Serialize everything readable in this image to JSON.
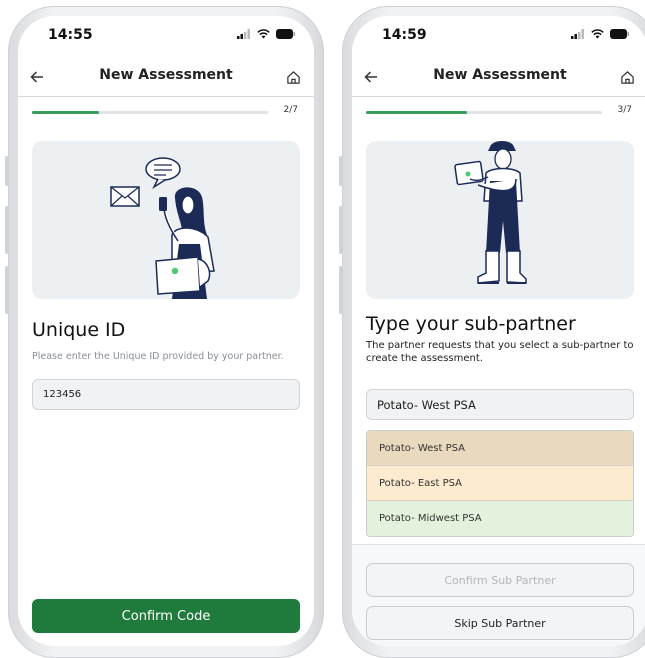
{
  "screen1": {
    "status_time": "14:55",
    "title": "New Assessment",
    "progress": {
      "label": "2/7",
      "fraction": 0.2857
    },
    "heading": "Unique ID",
    "subtext": "Please enter the Unique ID provided by your partner.",
    "input_value": "123456",
    "confirm_button": "Confirm Code"
  },
  "screen2": {
    "status_time": "14:59",
    "title": "New Assessment",
    "progress": {
      "label": "3/7",
      "fraction": 0.4286
    },
    "heading": "Type your sub-partner",
    "subtext": "The partner requests that you select a sub-partner to create the assessment.",
    "input_value": "Potato- West PSA",
    "options": [
      {
        "label": "Potato- West PSA",
        "color": "#e9d9bf"
      },
      {
        "label": "Potato- East PSA",
        "color": "#fdebd0"
      },
      {
        "label": "Potato- Midwest PSA",
        "color": "#e3f2dc"
      }
    ],
    "confirm_button": "Confirm Sub Partner",
    "skip_button": "Skip Sub Partner"
  },
  "colors": {
    "primary_green": "#1e7b3c",
    "progress_green": "#3a9b5c",
    "illustration_bg": "#edf0f3",
    "navy": "#1c2a56"
  },
  "icons": {
    "back": "arrow-left",
    "home": "home-outline",
    "signal": "cellular-signal",
    "wifi": "wifi",
    "battery": "battery"
  }
}
